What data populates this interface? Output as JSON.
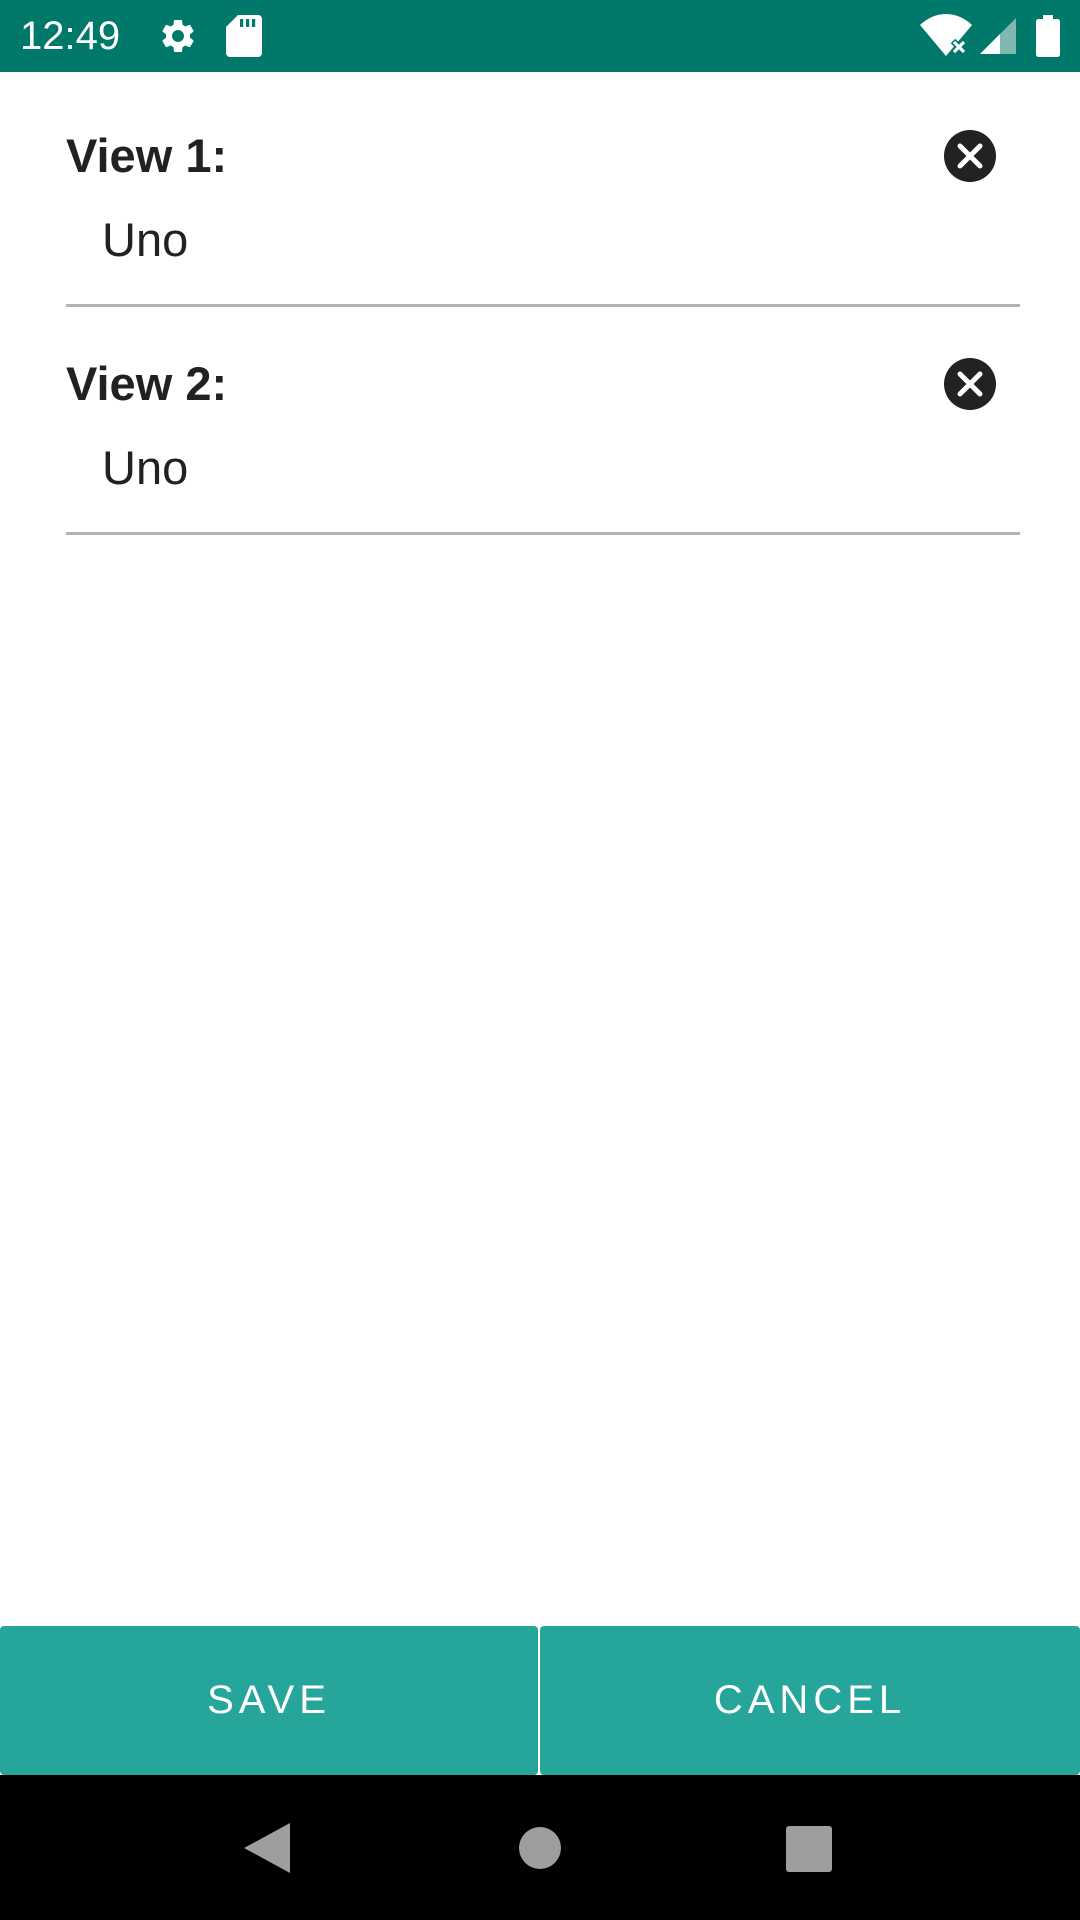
{
  "status_bar": {
    "time": "12:49",
    "icons": [
      "gear-icon",
      "sd-card-icon",
      "wifi-icon",
      "signal-icon",
      "battery-icon"
    ],
    "background": "#00796b"
  },
  "fields": [
    {
      "label": "View 1:",
      "value": "Uno",
      "clear_icon": "close-circle-icon"
    },
    {
      "label": "View 2:",
      "value": "Uno",
      "clear_icon": "close-circle-icon"
    }
  ],
  "actions": {
    "save_label": "SAVE",
    "cancel_label": "CANCEL",
    "button_color": "#26a69a"
  },
  "nav_bar": {
    "icons": [
      "back-icon",
      "home-icon",
      "recents-icon"
    ]
  }
}
